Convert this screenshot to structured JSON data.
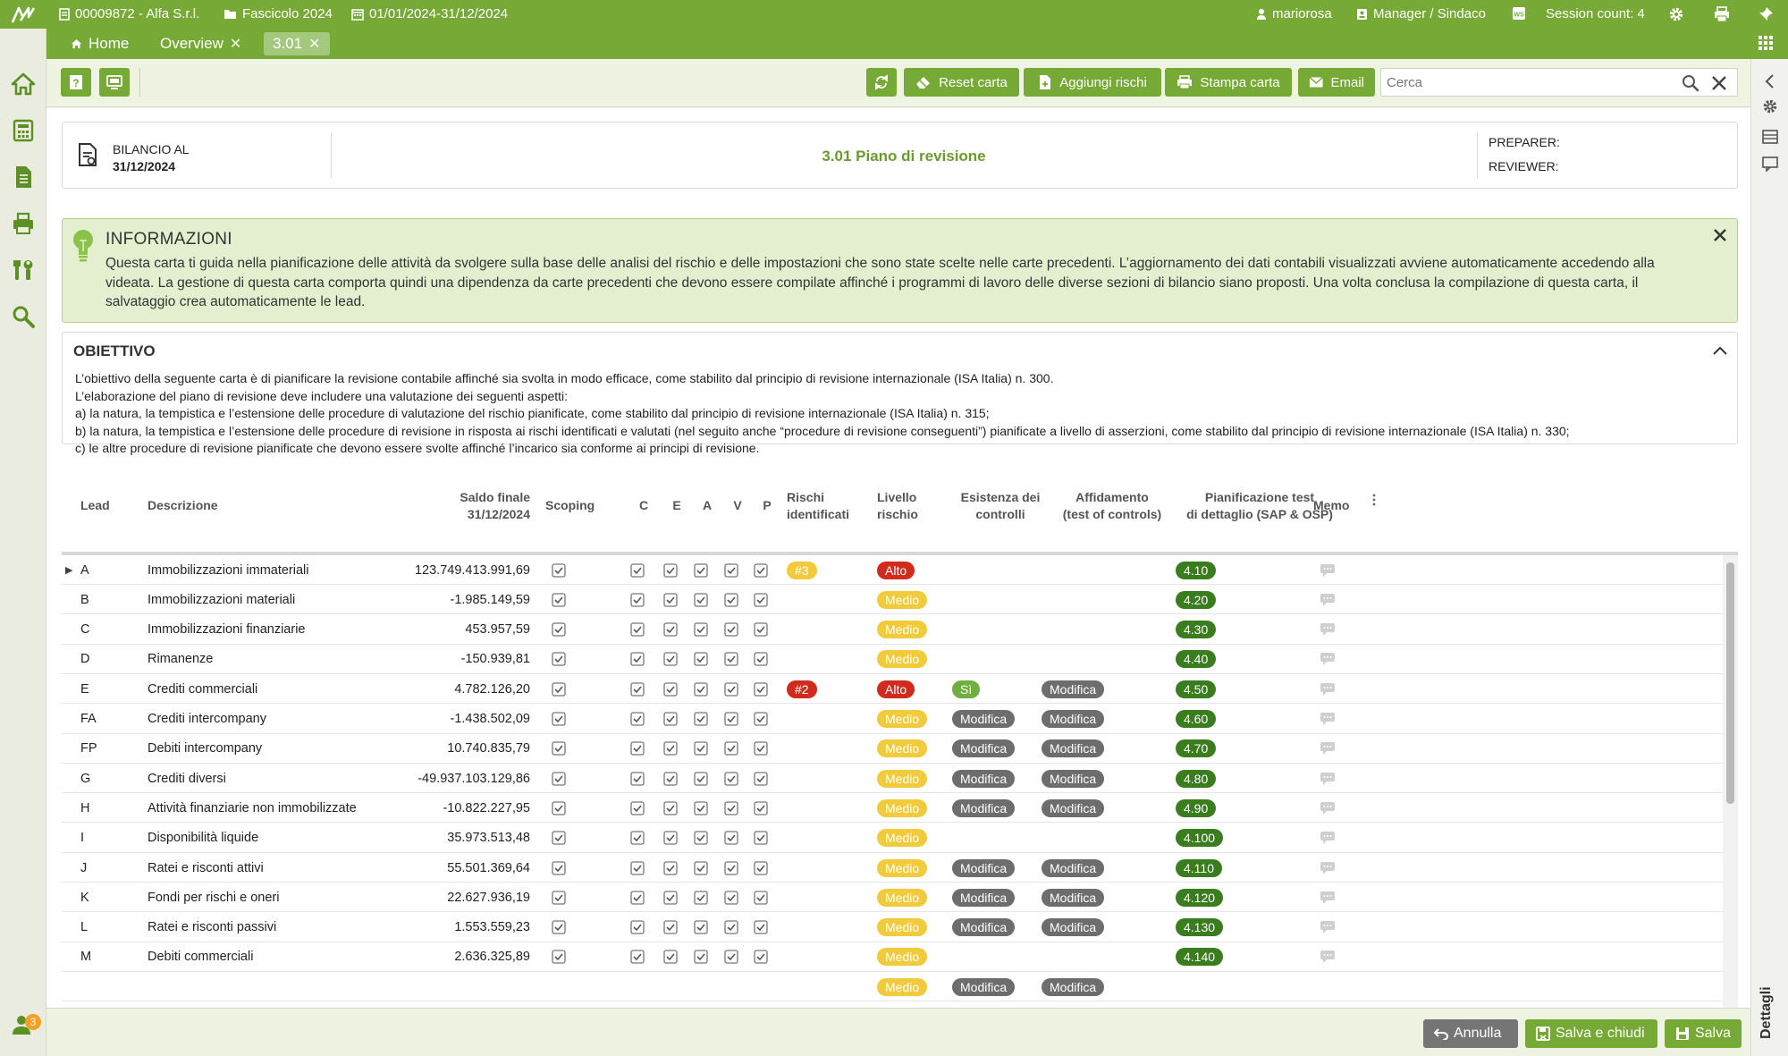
{
  "topbar": {
    "company": "00009872 - Alfa S.r.l.",
    "dossier": "Fascicolo 2024",
    "period": "01/01/2024-31/12/2024",
    "user": "mariorosa",
    "role": "Manager / Sindaco",
    "session": "Session count: 4"
  },
  "tabs": [
    {
      "label": "Home",
      "active": false
    },
    {
      "label": "Overview",
      "active": false
    },
    {
      "label": "3.01",
      "active": true
    }
  ],
  "toolbar": {
    "reset_label": "Reset carta",
    "add_risks_label": "Aggiungi rischi",
    "print_label": "Stampa carta",
    "email_label": "Email",
    "search_placeholder": "Cerca"
  },
  "header": {
    "balance_label": "BILANCIO AL",
    "balance_date": "31/12/2024",
    "title": "3.01 Piano di revisione",
    "preparer_label": "PREPARER:",
    "reviewer_label": "REVIEWER:"
  },
  "info": {
    "title": "INFORMAZIONI",
    "text": "Questa carta ti guida nella pianificazione delle attività da svolgere sulla base delle analisi del rischio e delle impostazioni che sono state scelte nelle carte precedenti. L’aggiornamento dei dati contabili visualizzati avviene automaticamente accedendo alla videata. La gestione di questa carta comporta quindi una dipendenza da carte precedenti che devono essere compilate affinché i programmi di lavoro delle diverse sezioni di bilancio siano proposti. Una volta conclusa la compilazione di questa carta, il salvataggio crea automaticamente le lead."
  },
  "objective": {
    "title": "OBIETTIVO",
    "lines": [
      "L’obiettivo della seguente carta è di pianificare la revisione contabile affinché sia svolta in modo efficace, come stabilito dal principio di revisione internazionale (ISA Italia) n. 300.",
      "L’elaborazione del piano di revisione deve includere una valutazione dei seguenti aspetti:",
      "a) la natura, la tempistica e l’estensione delle procedure di valutazione del rischio pianificate, come stabilito dal principio di revisione internazionale (ISA Italia) n. 315;",
      "b) la natura, la tempistica e l’estensione delle procedure di revisione in risposta ai rischi identificati e valutati (nel seguito anche “procedure di revisione conseguenti”) pianificate a livello di asserzioni, come stabilito dal principio di revisione internazionale (ISA Italia) n. 330;",
      "c) le altre procedure di revisione pianificate che devono essere svolte affinché l’incarico sia conforme ai principi di revisione."
    ]
  },
  "table": {
    "headers": {
      "lead": "Lead",
      "descrizione": "Descrizione",
      "saldo_1": "Saldo finale",
      "saldo_2": "31/12/2024",
      "scoping": "Scoping",
      "c": "C",
      "e": "E",
      "a": "A",
      "v": "V",
      "p": "P",
      "rischi_1": "Rischi",
      "rischi_2": "identificati",
      "livello_1": "Livello",
      "livello_2": "rischio",
      "esistenza_1": "Esistenza dei",
      "esistenza_2": "controlli",
      "affidamento_1": "Affidamento",
      "affidamento_2": "(test of controls)",
      "pianificazione_1": "Pianificazione test",
      "pianificazione_2": "di dettaglio (SAP & OSP)",
      "memo": "Memo"
    },
    "rows": [
      {
        "lead": "A",
        "desc": "Immobilizzazioni immateriali",
        "saldo": "123.749.413.991,69",
        "rischi": "#3",
        "livello": "Alto",
        "esistenza": "",
        "affidamento": "",
        "test": "4.10",
        "expandable": true
      },
      {
        "lead": "B",
        "desc": "Immobilizzazioni materiali",
        "saldo": "-1.985.149,59",
        "rischi": "",
        "livello": "Medio",
        "esistenza": "",
        "affidamento": "",
        "test": "4.20"
      },
      {
        "lead": "C",
        "desc": "Immobilizzazioni finanziarie",
        "saldo": "453.957,59",
        "rischi": "",
        "livello": "Medio",
        "esistenza": "",
        "affidamento": "",
        "test": "4.30"
      },
      {
        "lead": "D",
        "desc": "Rimanenze",
        "saldo": "-150.939,81",
        "rischi": "",
        "livello": "Medio",
        "esistenza": "",
        "affidamento": "",
        "test": "4.40"
      },
      {
        "lead": "E",
        "desc": "Crediti commerciali",
        "saldo": "4.782.126,20",
        "rischi": "#2",
        "livello": "Alto",
        "esistenza": "Sì",
        "affidamento": "Modifica",
        "test": "4.50"
      },
      {
        "lead": "FA",
        "desc": "Crediti intercompany",
        "saldo": "-1.438.502,09",
        "rischi": "",
        "livello": "Medio",
        "esistenza": "Modifica",
        "affidamento": "Modifica",
        "test": "4.60"
      },
      {
        "lead": "FP",
        "desc": "Debiti intercompany",
        "saldo": "10.740.835,79",
        "rischi": "",
        "livello": "Medio",
        "esistenza": "Modifica",
        "affidamento": "Modifica",
        "test": "4.70"
      },
      {
        "lead": "G",
        "desc": "Crediti diversi",
        "saldo": "-49.937.103.129,86",
        "rischi": "",
        "livello": "Medio",
        "esistenza": "Modifica",
        "affidamento": "Modifica",
        "test": "4.80"
      },
      {
        "lead": "H",
        "desc": "Attività finanziarie non immobilizzate",
        "saldo": "-10.822.227,95",
        "rischi": "",
        "livello": "Medio",
        "esistenza": "Modifica",
        "affidamento": "Modifica",
        "test": "4.90"
      },
      {
        "lead": "I",
        "desc": "Disponibilità liquide",
        "saldo": "35.973.513,48",
        "rischi": "",
        "livello": "Medio",
        "esistenza": "",
        "affidamento": "",
        "test": "4.100"
      },
      {
        "lead": "J",
        "desc": "Ratei e risconti attivi",
        "saldo": "55.501.369,64",
        "rischi": "",
        "livello": "Medio",
        "esistenza": "Modifica",
        "affidamento": "Modifica",
        "test": "4.110"
      },
      {
        "lead": "K",
        "desc": "Fondi per rischi e oneri",
        "saldo": "22.627.936,19",
        "rischi": "",
        "livello": "Medio",
        "esistenza": "Modifica",
        "affidamento": "Modifica",
        "test": "4.120"
      },
      {
        "lead": "L",
        "desc": "Ratei e risconti passivi",
        "saldo": "1.553.559,23",
        "rischi": "",
        "livello": "Medio",
        "esistenza": "Modifica",
        "affidamento": "Modifica",
        "test": "4.130"
      },
      {
        "lead": "M",
        "desc": "Debiti commerciali",
        "saldo": "2.636.325,89",
        "rischi": "",
        "livello": "Medio",
        "esistenza": "",
        "affidamento": "",
        "test": "4.140"
      },
      {
        "lead": "",
        "desc": "",
        "saldo": "",
        "rischi": "",
        "livello": "Medio",
        "esistenza": "Modifica",
        "affidamento": "Modifica",
        "test": ""
      }
    ]
  },
  "footer": {
    "annulla_label": "Annulla",
    "salva_chiudi_label": "Salva e chiudi",
    "salva_label": "Salva"
  },
  "sidebar": {
    "right_label": "Dettagli",
    "notifications_count": "3"
  },
  "colors": {
    "brand_green": "#76a935",
    "risk_high": "#d32a1e",
    "risk_medium": "#f2cb3c",
    "modify_gray": "#6d6d6d",
    "test_green": "#3a7d1e"
  }
}
